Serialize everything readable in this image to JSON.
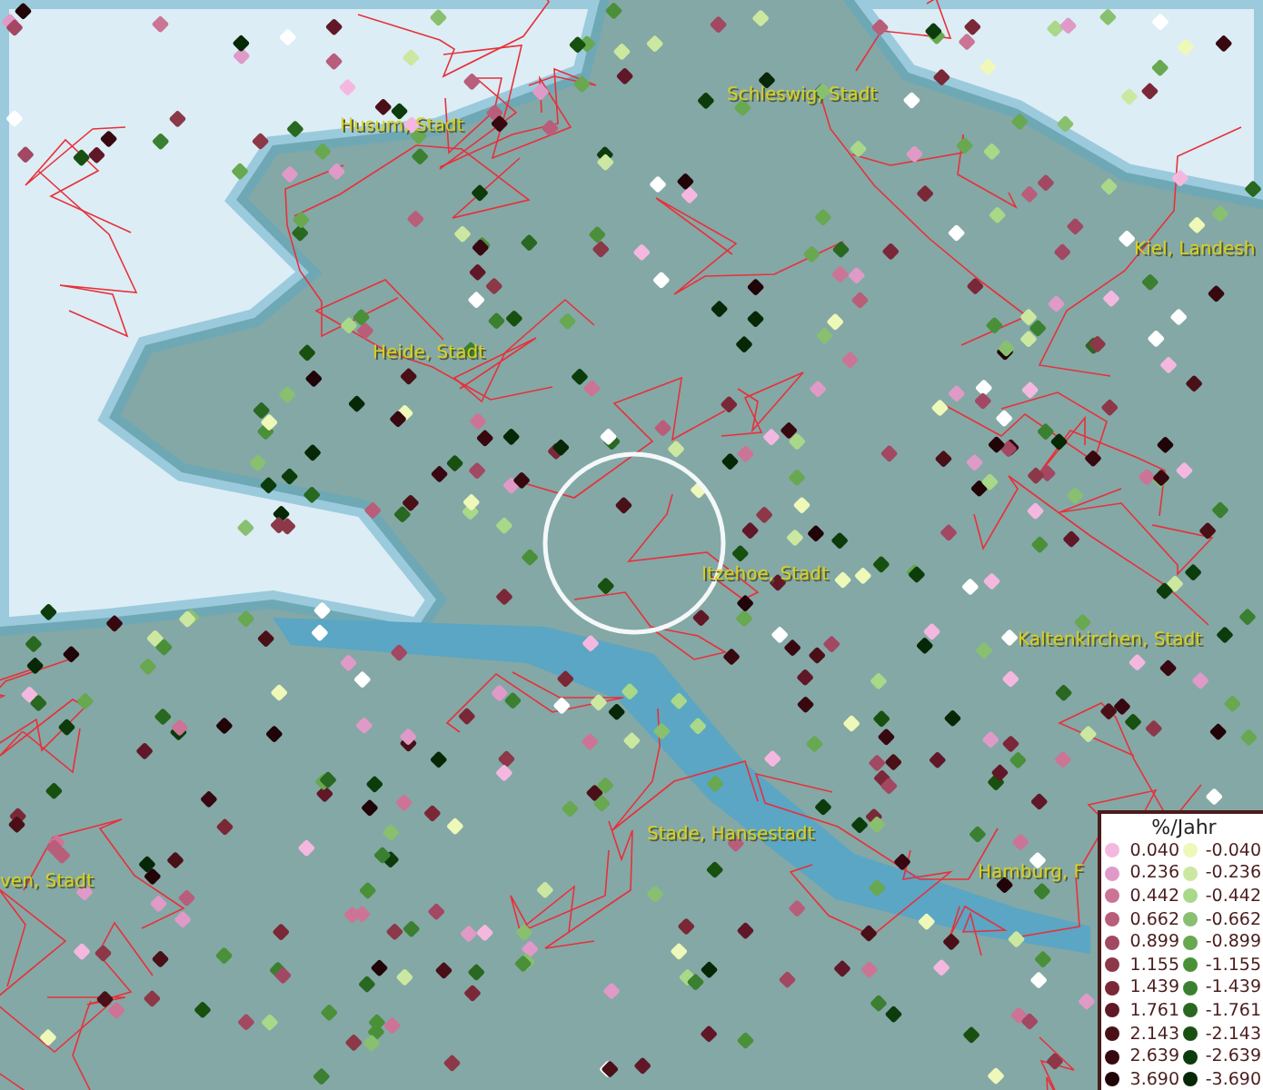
{
  "map": {
    "places": [
      {
        "name": "Husum, Stadt"
      },
      {
        "name": "Schleswig, Stadt"
      },
      {
        "name": "Kiel, Landesh"
      },
      {
        "name": "Heide, Stadt"
      },
      {
        "name": "Itzehoe, Stadt"
      },
      {
        "name": "Kaltenkirchen, Stadt"
      },
      {
        "name": "Stade, Hansestadt"
      },
      {
        "name": "Hamburg, F"
      },
      {
        "name": "ven, Stadt"
      }
    ]
  },
  "legend": {
    "title": "%/Jahr",
    "columns": [
      {
        "items": [
          {
            "label": "0.040",
            "color": "#f4b8e0"
          },
          {
            "label": "0.236",
            "color": "#e09ac8"
          },
          {
            "label": "0.442",
            "color": "#cc7496"
          },
          {
            "label": "0.662",
            "color": "#b85e7a"
          },
          {
            "label": "0.899",
            "color": "#a24862"
          },
          {
            "label": "1.155",
            "color": "#8c3848"
          },
          {
            "label": "1.439",
            "color": "#7a2838"
          },
          {
            "label": "1.761",
            "color": "#601828"
          },
          {
            "label": "2.143",
            "color": "#4a1018"
          },
          {
            "label": "2.639",
            "color": "#380810"
          },
          {
            "label": "3.690",
            "color": "#200408"
          }
        ]
      },
      {
        "items": [
          {
            "label": "-0.040",
            "color": "#eef8b8"
          },
          {
            "label": "-0.236",
            "color": "#cce8a0"
          },
          {
            "label": "-0.442",
            "color": "#a8d888"
          },
          {
            "label": "-0.662",
            "color": "#88c070"
          },
          {
            "label": "-0.899",
            "color": "#68a850"
          },
          {
            "label": "-1.155",
            "color": "#4a9038"
          },
          {
            "label": "-1.439",
            "color": "#3a8030"
          },
          {
            "label": "-1.761",
            "color": "#286820"
          },
          {
            "label": "-2.143",
            "color": "#185010"
          },
          {
            "label": "-2.639",
            "color": "#0c3c0c"
          },
          {
            "label": "-3.690",
            "color": "#062806"
          }
        ]
      }
    ]
  }
}
